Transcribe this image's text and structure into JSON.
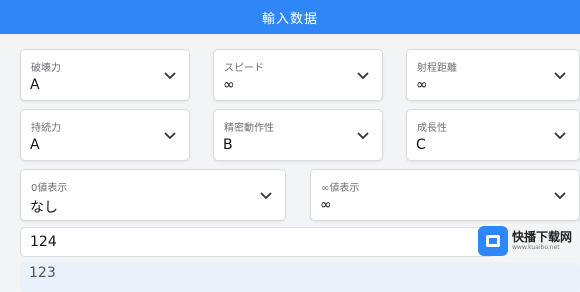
{
  "header": {
    "title": "輸入数据"
  },
  "fields": [
    {
      "label": "破壊力",
      "value": "A"
    },
    {
      "label": "スピード",
      "value": "∞"
    },
    {
      "label": "射程距離",
      "value": "∞"
    },
    {
      "label": "持続力",
      "value": "A"
    },
    {
      "label": "精密動作性",
      "value": "B"
    },
    {
      "label": "成長性",
      "value": "C"
    },
    {
      "label": "0値表示",
      "value": "なし"
    },
    {
      "label": "∞値表示",
      "value": "∞"
    }
  ],
  "inputs": {
    "primary": "124",
    "secondary": "123"
  },
  "watermark": {
    "name": "快播下载网",
    "url": "www.kuaibo.net"
  },
  "colors": {
    "accent": "#2f86f6",
    "background": "#f3f4f6"
  },
  "icons": {
    "dropdown": "chevron-down-icon",
    "watermark": "box-logo-icon"
  }
}
